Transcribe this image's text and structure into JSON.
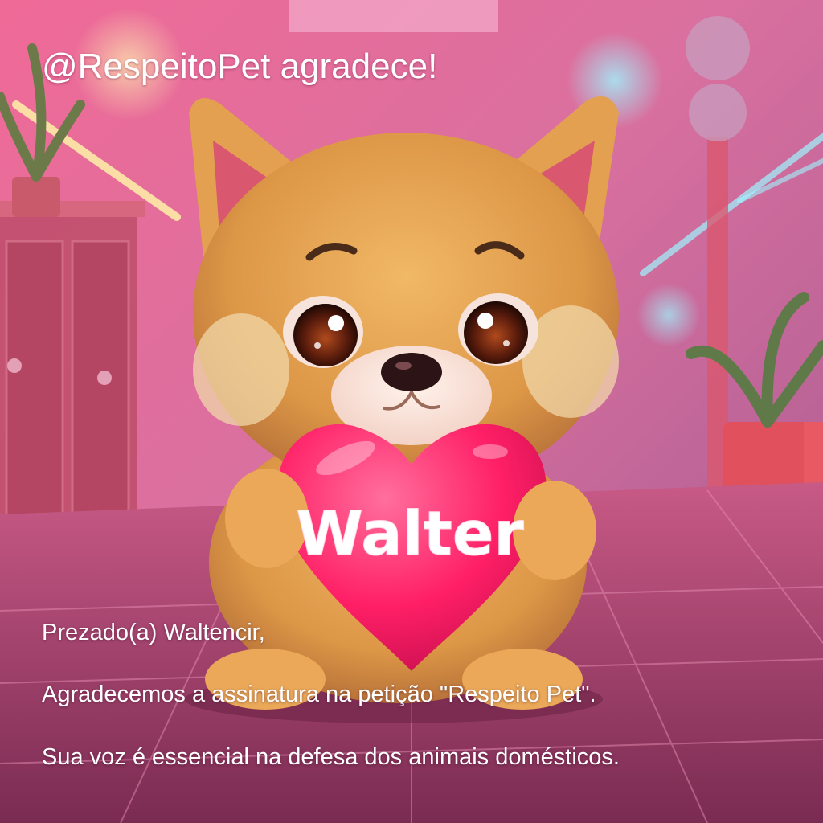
{
  "header": {
    "title": "@RespeitoPet agradece!"
  },
  "heart": {
    "name": "Walter"
  },
  "message": {
    "greeting": "Prezado(a) Waltencir,",
    "line1": "Agradecemos a assinatura na petição \"Respeito Pet\".",
    "line2": "Sua voz é essencial na defesa dos animais domésticos."
  },
  "colors": {
    "background": "#e86f9a",
    "fur": "#e4a04e",
    "heart": "#ff2a6d",
    "text": "#ffffff"
  },
  "icons": [
    "puppy-illustration",
    "heart-shape"
  ]
}
